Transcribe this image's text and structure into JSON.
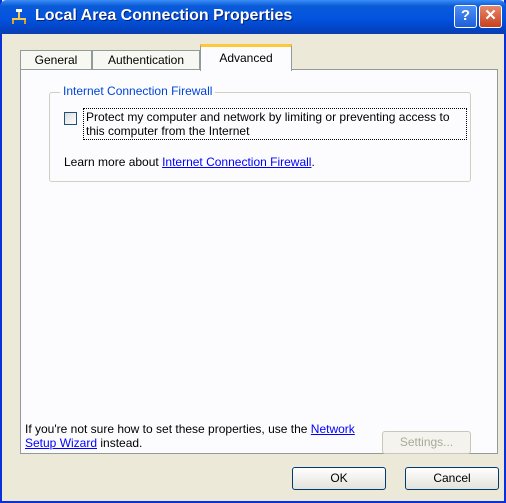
{
  "window": {
    "title": "Local Area Connection Properties",
    "help_glyph": "?",
    "close_glyph": "✕"
  },
  "tabs": [
    {
      "label": "General",
      "active": false
    },
    {
      "label": "Authentication",
      "active": false
    },
    {
      "label": "Advanced",
      "active": true
    }
  ],
  "firewall": {
    "group_title": "Internet Connection Firewall",
    "checkbox_label": "Protect my computer and network by limiting or preventing access to this computer from the Internet",
    "checked": false,
    "learn_prefix": "Learn more about ",
    "learn_link": "Internet Connection Firewall",
    "learn_suffix": "."
  },
  "hint": {
    "prefix": "If you're not sure how to set these properties, use the ",
    "link": "Network Setup Wizard",
    "suffix": " instead."
  },
  "buttons": {
    "settings": "Settings...",
    "ok": "OK",
    "cancel": "Cancel"
  }
}
